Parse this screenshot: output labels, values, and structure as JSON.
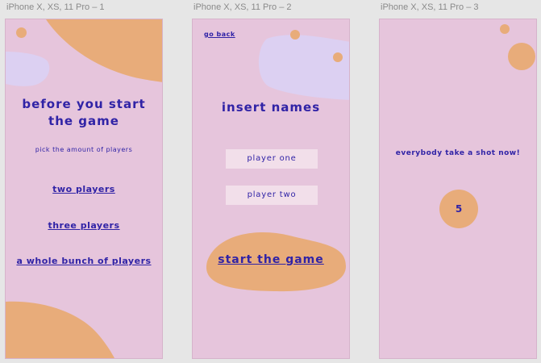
{
  "frames": {
    "f1": {
      "title": "iPhone X, XS, 11 Pro – 1",
      "heading_line1": "before you start",
      "heading_line2": "the game",
      "subtitle": "pick the amount of players",
      "options": [
        "two players",
        "three players",
        "a whole bunch of players"
      ]
    },
    "f2": {
      "title": "iPhone X, XS, 11 Pro – 2",
      "back_label": "go back",
      "heading": "insert names",
      "player_one_value": "player one",
      "player_two_value": "player two",
      "start_label": "start the game"
    },
    "f3": {
      "title": "iPhone X, XS, 11 Pro – 3",
      "message": "everybody take a shot now!",
      "countdown": "5"
    }
  },
  "colors": {
    "artboard_bg": "#e6c5dc",
    "canvas_bg": "#e6e6e6",
    "accent_orange": "#e8ac7a",
    "accent_lavender": "#dcd0f2",
    "text_primary": "#3023a6"
  }
}
